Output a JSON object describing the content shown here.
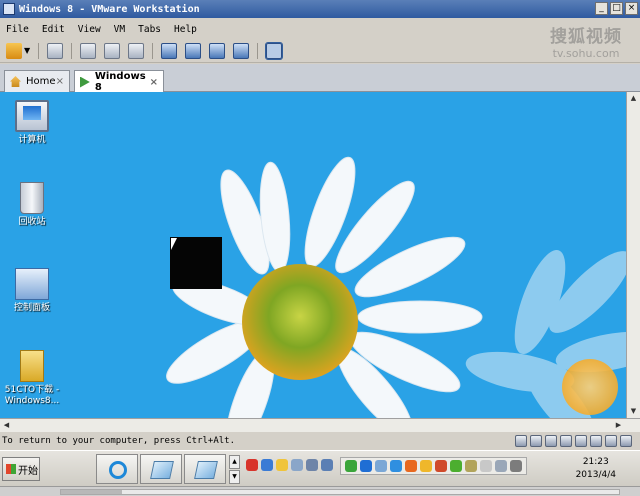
{
  "window": {
    "title": "Windows 8 - VMware Workstation",
    "min_glyph": "_",
    "max_glyph": "□",
    "close_glyph": "×"
  },
  "watermark": {
    "line1": "搜狐视频",
    "line2": "tv.sohu.com"
  },
  "menu": {
    "items": [
      "File",
      "Edit",
      "View",
      "VM",
      "Tabs",
      "Help"
    ]
  },
  "tabs": [
    {
      "label": "Home",
      "icon": "home-icon",
      "close": "×"
    },
    {
      "label": "Windows 8",
      "icon": "vm-icon",
      "close": "×",
      "active": true
    }
  ],
  "desktop": {
    "icons": [
      {
        "label": "计算机",
        "icon": "computer-icon"
      },
      {
        "label": "回收站",
        "icon": "recycle-bin-icon"
      },
      {
        "label": "控制面板",
        "icon": "control-panel-icon"
      },
      {
        "label": "51CTO下载 -Windows8...",
        "icon": "folder-icon"
      }
    ]
  },
  "status": {
    "text": "To return to your computer, press Ctrl+Alt."
  },
  "taskbar": {
    "start_label": "开始",
    "clock_time": "21:23",
    "clock_date": "2013/4/4"
  },
  "colors": {
    "title_bar": "#2f5aa0",
    "desktop_sky": "#2aa2e6",
    "tab_strip": "#c9ced6"
  },
  "playback": {
    "progress_fraction": 0.11
  }
}
